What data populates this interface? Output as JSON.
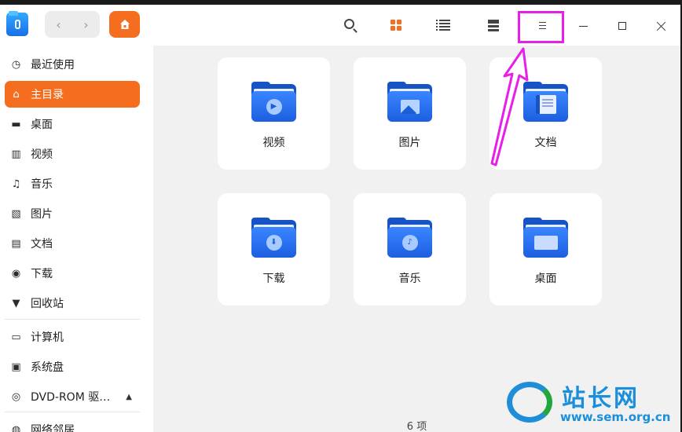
{
  "toolbar": {
    "app_icon": "file-manager-icon",
    "back_icon": "‹",
    "forward_icon": "›",
    "home_crumb_icon": "home-icon",
    "search_icon": "search-icon",
    "view_icons": "icon-view-icon",
    "view_list": "list-view-icon",
    "view_tree": "tree-view-icon",
    "menu_icon": "hamburger-menu-icon",
    "minimize_icon": "minimize-icon",
    "maximize_icon": "maximize-icon",
    "close_icon": "close-icon"
  },
  "sidebar": {
    "items": [
      {
        "label": "最近使用",
        "icon": "clock-icon"
      },
      {
        "label": "主目录",
        "icon": "home-icon"
      },
      {
        "label": "桌面",
        "icon": "desktop-icon"
      },
      {
        "label": "视频",
        "icon": "video-icon"
      },
      {
        "label": "音乐",
        "icon": "music-icon"
      },
      {
        "label": "图片",
        "icon": "picture-icon"
      },
      {
        "label": "文档",
        "icon": "document-icon"
      },
      {
        "label": "下载",
        "icon": "download-icon"
      },
      {
        "label": "回收站",
        "icon": "trash-icon"
      },
      {
        "label": "计算机",
        "icon": "computer-icon"
      },
      {
        "label": "系统盘",
        "icon": "disk-icon"
      },
      {
        "label": "DVD-ROM 驱…",
        "icon": "optical-disc-icon"
      },
      {
        "label": "网络邻居",
        "icon": "network-icon"
      }
    ],
    "eject_icon": "▲",
    "active_index": 1
  },
  "main": {
    "folders": [
      {
        "label": "视频",
        "icon": "video-folder-icon"
      },
      {
        "label": "图片",
        "icon": "picture-folder-icon"
      },
      {
        "label": "文档",
        "icon": "document-folder-icon"
      },
      {
        "label": "下载",
        "icon": "download-folder-icon"
      },
      {
        "label": "音乐",
        "icon": "music-folder-icon"
      },
      {
        "label": "桌面",
        "icon": "desktop-folder-icon"
      }
    ],
    "status": "6 项"
  },
  "annotation": {
    "color": "#e81fe8"
  },
  "watermark": {
    "text_cn": "站长网",
    "url": "www.sem.org.cn"
  },
  "colors": {
    "accent": "#f56d1f",
    "folder_blue": "#1c5fe0"
  }
}
